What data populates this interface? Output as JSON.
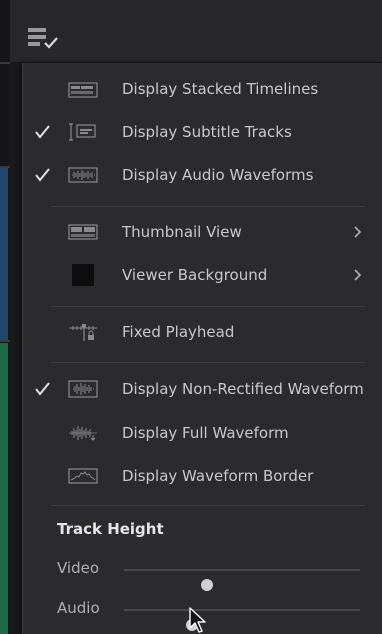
{
  "menu": {
    "items": [
      {
        "label": "Display Stacked Timelines",
        "checked": false,
        "submenu": false,
        "icon": "stacked-timelines-icon"
      },
      {
        "label": "Display Subtitle Tracks",
        "checked": true,
        "submenu": false,
        "icon": "subtitle-tracks-icon"
      },
      {
        "label": "Display Audio Waveforms",
        "checked": true,
        "submenu": false,
        "icon": "audio-waveforms-icon"
      },
      {
        "label": "Thumbnail View",
        "checked": false,
        "submenu": true,
        "icon": "thumbnail-view-icon"
      },
      {
        "label": "Viewer Background",
        "checked": false,
        "submenu": true,
        "icon": "viewer-background-swatch"
      },
      {
        "label": "Fixed Playhead",
        "checked": false,
        "submenu": false,
        "icon": "fixed-playhead-icon"
      },
      {
        "label": "Display Non-Rectified Waveform",
        "checked": true,
        "submenu": false,
        "icon": "non-rectified-waveform-icon"
      },
      {
        "label": "Display Full Waveform",
        "checked": false,
        "submenu": false,
        "icon": "full-waveform-icon"
      },
      {
        "label": "Display Waveform Border",
        "checked": false,
        "submenu": false,
        "icon": "waveform-border-icon"
      }
    ],
    "track_height": {
      "title": "Track Height",
      "video": {
        "label": "Video",
        "value": 0.35
      },
      "audio": {
        "label": "Audio",
        "value": 0.29
      }
    }
  },
  "colors": {
    "menu_bg": "#2b2b2e",
    "text": "#c9c9cc",
    "check": "#e0e0e2",
    "viewer_swatch": "#0d0d0d"
  }
}
